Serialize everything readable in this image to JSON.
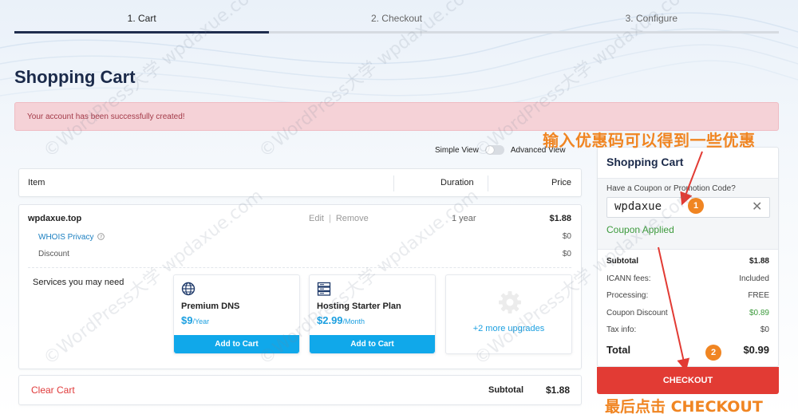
{
  "steps": [
    "1. Cart",
    "2. Checkout",
    "3. Configure"
  ],
  "page_title": "Shopping Cart",
  "alert": "Your account has been successfully created!",
  "view_toggle": {
    "simple": "Simple View",
    "advanced": "Advanced View"
  },
  "table_head": {
    "item": "Item",
    "duration": "Duration",
    "price": "Price"
  },
  "cart_item": {
    "domain": "wpdaxue.top",
    "edit": "Edit",
    "remove": "Remove",
    "duration": "1 year",
    "price": "$1.88",
    "whois": "WHOIS Privacy",
    "whois_price": "$0",
    "discount": "Discount",
    "discount_price": "$0"
  },
  "services": {
    "label": "Services you may need",
    "items": [
      {
        "name": "Premium DNS",
        "price": "$9",
        "period": "/Year",
        "button": "Add to Cart"
      },
      {
        "name": "Hosting Starter Plan",
        "price": "$2.99",
        "period": "/Month",
        "button": "Add to Cart"
      }
    ],
    "more": "+2 more upgrades"
  },
  "footer": {
    "clear_cart": "Clear Cart",
    "subtotal_label": "Subtotal",
    "subtotal_value": "$1.88"
  },
  "summary": {
    "title": "Shopping Cart",
    "coupon_question": "Have a Coupon or Promotion Code?",
    "coupon_value": "wpdaxue",
    "coupon_status": "Coupon Applied",
    "lines": [
      {
        "label": "Subtotal",
        "value": "$1.88"
      },
      {
        "label": "ICANN fees:",
        "value": "Included"
      },
      {
        "label": "Processing:",
        "value": "FREE"
      },
      {
        "label": "Coupon Discount",
        "value": "$0.89"
      },
      {
        "label": "Tax info:",
        "value": "$0"
      }
    ],
    "total_label": "Total",
    "total_value": "$0.99",
    "checkout": "CHECKOUT"
  },
  "annotations": {
    "top": "输入优惠码可以得到一些优惠",
    "bottom": "最后点击 CHECKOUT",
    "badge1": "1",
    "badge2": "2"
  },
  "watermark": "©WordPress大学 wpdaxue.com",
  "colors": {
    "accent": "#10a8ea",
    "checkout": "#e23b34",
    "annotation": "#f08522",
    "success": "#3c9a3c",
    "alert_bg": "#f5d2d7"
  }
}
